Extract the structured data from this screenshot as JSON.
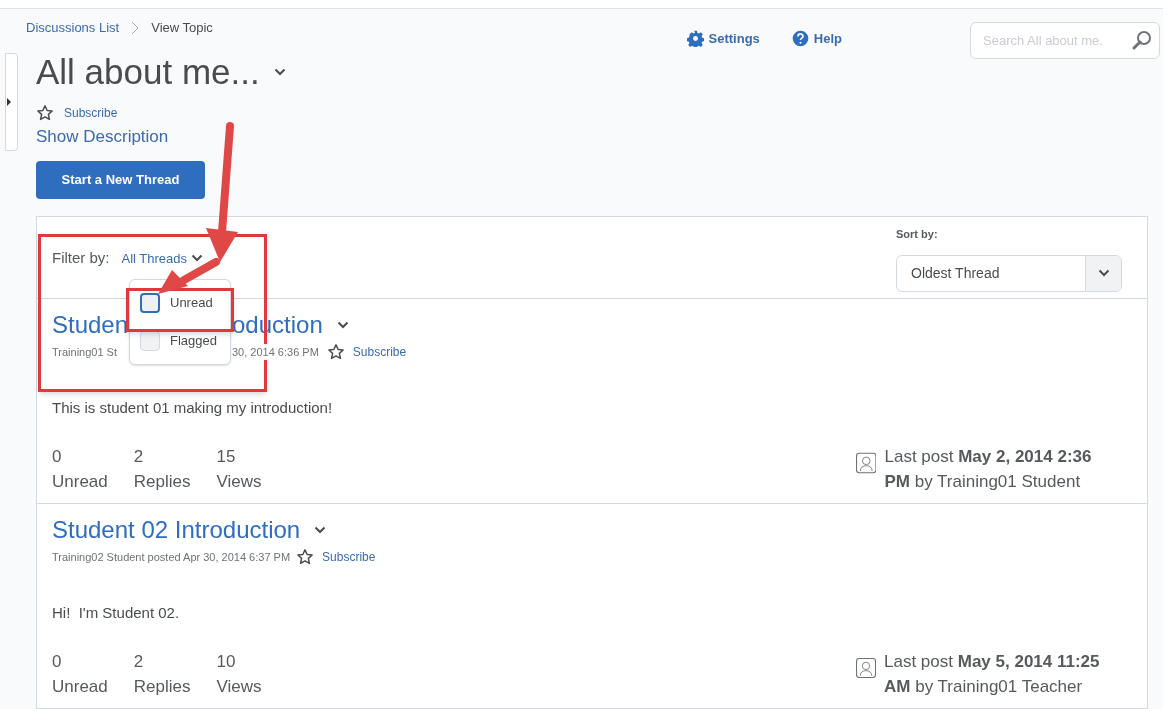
{
  "breadcrumbs": [
    {
      "label": "Discussions List",
      "link": true
    },
    {
      "label": "View Topic",
      "link": false
    }
  ],
  "header_links": [
    {
      "kind": "settings",
      "label": "Settings"
    },
    {
      "kind": "help",
      "label": "Help"
    }
  ],
  "search": {
    "placeholder": "Search All about me."
  },
  "topic": {
    "title": "All about me...",
    "subscribe": "Subscribe",
    "show_description": "Show Description",
    "new_thread_button": "Start a New Thread"
  },
  "filter": {
    "label": "Filter by:",
    "value": "All Threads",
    "menu": [
      {
        "label": "Unread",
        "checked": false,
        "focused": true
      },
      {
        "label": "Flagged",
        "checked": false,
        "focused": false
      }
    ]
  },
  "sort": {
    "label": "Sort by:",
    "value": "Oldest Thread"
  },
  "threads": [
    {
      "title_parts": [
        "Studen",
        "oduction"
      ],
      "meta_parts": [
        "Training01 St",
        "30, 2014 6:36 PM"
      ],
      "subscribe": "Subscribe",
      "body": "This is student 01 making my introduction!",
      "stats": [
        {
          "value": "0",
          "label": "Unread"
        },
        {
          "value": "2",
          "label": "Replies"
        },
        {
          "value": "15",
          "label": "Views"
        }
      ],
      "last_post": "Last post **May 2, 2014 2:36 PM** by Training01 Student"
    },
    {
      "title_parts": [
        "Student 02 Introduction"
      ],
      "meta_parts": [
        "Training02 Student posted Apr 30, 2014 6:37 PM"
      ],
      "subscribe": "Subscribe",
      "body": "Hi!  I'm Student 02.",
      "stats": [
        {
          "value": "0",
          "label": "Unread"
        },
        {
          "value": "2",
          "label": "Replies"
        },
        {
          "value": "10",
          "label": "Views"
        }
      ],
      "last_post": "Last post **May 5, 2014 11:25 AM** by Training01 Teacher"
    }
  ]
}
